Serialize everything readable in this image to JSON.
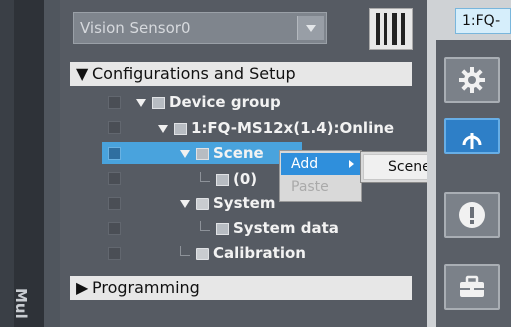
{
  "sensor_select": {
    "value": "Vision Sensor0"
  },
  "config_header": {
    "label": "Configurations and Setup"
  },
  "tree": {
    "device_group": "Device group",
    "device": "1:FQ-MS12x(1.4):Online",
    "scene": "Scene",
    "scene_item": "(0)",
    "system": "System",
    "system_data": "System data",
    "calibration": "Calibration"
  },
  "context_menu": {
    "add": "Add",
    "paste": "Paste"
  },
  "submenu": {
    "scene_data": "Scene data"
  },
  "programming_header": {
    "label": "Programming"
  },
  "top_tab": {
    "label": "1:FQ-"
  },
  "left_strip": {
    "label": "Mul"
  },
  "right_tools": {
    "icons": [
      "gear-icon",
      "online-icon",
      "warning-icon",
      "toolbox-icon"
    ]
  }
}
